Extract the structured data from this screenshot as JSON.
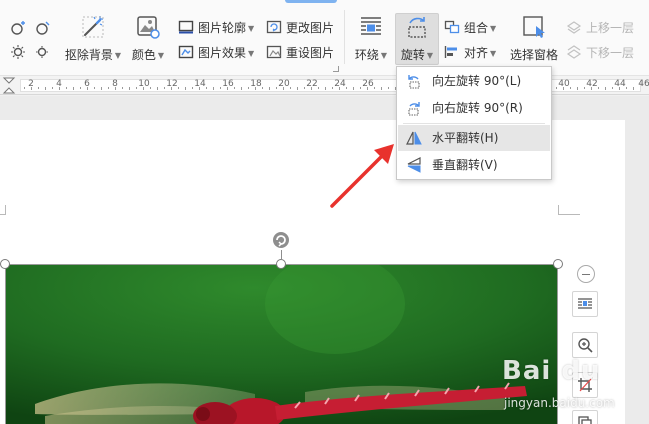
{
  "ribbon": {
    "remove_bg": "抠除背景",
    "color": "颜色",
    "pic_outline": "图片轮廓",
    "pic_effect": "图片效果",
    "change_pic": "更改图片",
    "reset_pic": "重设图片",
    "wrap": "环绕",
    "rotate": "旋转",
    "group": "组合",
    "align": "对齐",
    "selection_pane": "选择窗格",
    "bring_forward": "上移一层",
    "send_backward": "下移一层"
  },
  "ruler": {
    "labels": [
      "2",
      "4",
      "6",
      "8",
      "10",
      "12",
      "14",
      "16",
      "18",
      "20",
      "22",
      "24",
      "26",
      "40",
      "42",
      "44",
      "46"
    ]
  },
  "rotate_menu": {
    "items": [
      {
        "label": "向左旋转 90°(L)",
        "icon": "rotate-left-icon"
      },
      {
        "label": "向右旋转 90°(R)",
        "icon": "rotate-right-icon"
      },
      {
        "label": "水平翻转(H)",
        "icon": "flip-horizontal-icon"
      },
      {
        "label": "垂直翻转(V)",
        "icon": "flip-vertical-icon"
      }
    ],
    "highlighted_index": 2
  },
  "watermark": {
    "line1": "Bai du",
    "line2": "jingyan.baidu.com"
  },
  "colors": {
    "accent": "#4d8ee8",
    "arrow": "#e8322d",
    "photo_bg": "#1a5d1c"
  }
}
